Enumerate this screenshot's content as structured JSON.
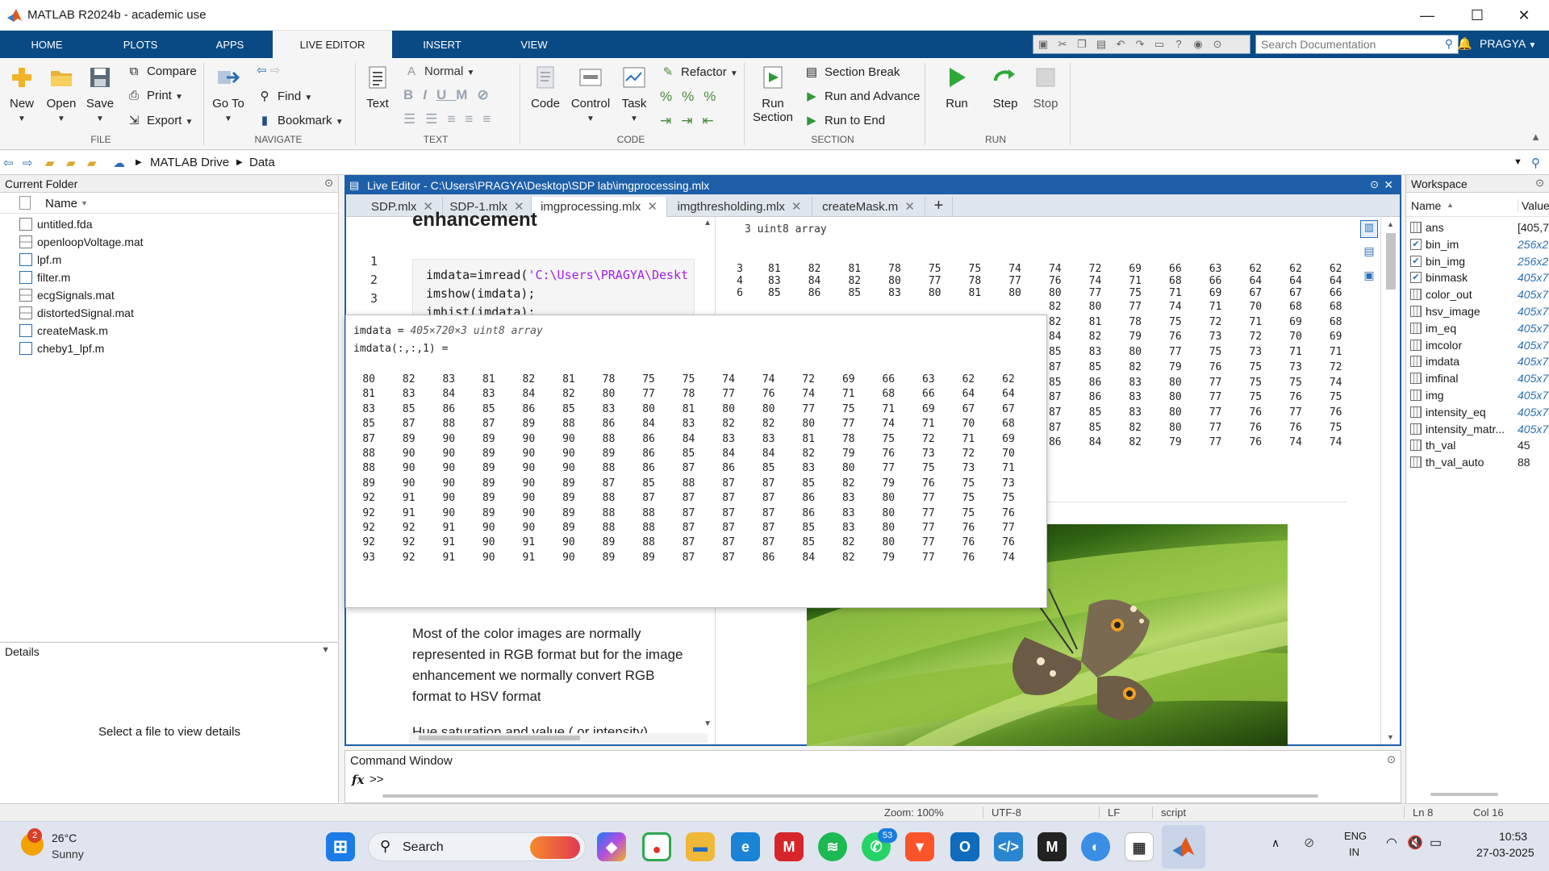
{
  "window": {
    "title": "MATLAB R2024b - academic use"
  },
  "ribbon_tabs": [
    "HOME",
    "PLOTS",
    "APPS",
    "LIVE EDITOR",
    "INSERT",
    "VIEW"
  ],
  "active_tab": "LIVE EDITOR",
  "search": {
    "placeholder": "Search Documentation"
  },
  "user": "PRAGYA",
  "ribbon": {
    "file": {
      "group": "FILE",
      "new": "New",
      "open": "Open",
      "save": "Save",
      "compare": "Compare",
      "print": "Print",
      "export": "Export"
    },
    "navigate": {
      "group": "NAVIGATE",
      "goto": "Go To",
      "find": "Find",
      "bookmark": "Bookmark"
    },
    "text": {
      "group": "TEXT",
      "text": "Text",
      "style": "Normal"
    },
    "code": {
      "group": "CODE",
      "code": "Code",
      "control": "Control",
      "task": "Task",
      "refactor": "Refactor"
    },
    "section": {
      "group": "SECTION",
      "run_section": "Run Section",
      "section_break": "Section Break",
      "run_and_advance": "Run and Advance",
      "run_to_end": "Run to End"
    },
    "run": {
      "group": "RUN",
      "run": "Run",
      "step": "Step",
      "stop": "Stop"
    }
  },
  "address": {
    "drive": "MATLAB Drive",
    "folder": "Data"
  },
  "current_folder": {
    "title": "Current Folder",
    "column": "Name",
    "files": [
      "untitled.fda",
      "openloopVoltage.mat",
      "lpf.m",
      "filter.m",
      "ecgSignals.mat",
      "distortedSignal.mat",
      "createMask.m",
      "cheby1_lpf.m"
    ]
  },
  "details": {
    "title": "Details",
    "message": "Select a file to view details"
  },
  "editor": {
    "title": "Live Editor - C:\\Users\\PRAGYA\\Desktop\\SDP lab\\imgprocessing.mlx",
    "tabs": [
      "SDP.mlx",
      "SDP-1.mlx",
      "imgprocessing.mlx",
      "imgthresholding.mlx",
      "createMask.m"
    ],
    "active_tab": "imgprocessing.mlx",
    "heading": "enhancement",
    "code": {
      "l1_prefix": "imdata=imread(",
      "l1_string": "'C:\\Users\\PRAGYA\\Deskt",
      "l2": "imshow(imdata);",
      "l3": "imhist(imdata);"
    },
    "paragraph": "Most of the color images are normally represented in RGB format but for the image enhancement we normally convert RGB format to HSV format",
    "paragraph2": "Hue saturation and value ( or intensity)"
  },
  "output": {
    "array_label": "3 uint8 array",
    "rows": [
      [
        "3",
        "81",
        "82",
        "81",
        "78",
        "75",
        "75",
        "74",
        "74",
        "72",
        "69",
        "66",
        "63",
        "62",
        "62",
        "62"
      ],
      [
        "4",
        "83",
        "84",
        "82",
        "80",
        "77",
        "78",
        "77",
        "76",
        "74",
        "71",
        "68",
        "66",
        "64",
        "64",
        "64"
      ],
      [
        "6",
        "85",
        "86",
        "85",
        "83",
        "80",
        "81",
        "80",
        "80",
        "77",
        "75",
        "71",
        "69",
        "67",
        "67",
        "66"
      ],
      [
        "82",
        "80",
        "77",
        "74",
        "71",
        "70",
        "68",
        "68"
      ],
      [
        "82",
        "81",
        "78",
        "75",
        "72",
        "71",
        "69",
        "68"
      ],
      [
        "84",
        "82",
        "79",
        "76",
        "73",
        "72",
        "70",
        "69"
      ],
      [
        "85",
        "83",
        "80",
        "77",
        "75",
        "73",
        "71",
        "71"
      ],
      [
        "87",
        "85",
        "82",
        "79",
        "76",
        "75",
        "73",
        "72"
      ],
      [
        "85",
        "86",
        "83",
        "80",
        "77",
        "75",
        "75",
        "74"
      ],
      [
        "87",
        "86",
        "83",
        "80",
        "77",
        "75",
        "76",
        "75"
      ],
      [
        "87",
        "85",
        "83",
        "80",
        "77",
        "76",
        "77",
        "76"
      ],
      [
        "87",
        "85",
        "82",
        "80",
        "77",
        "76",
        "76",
        "75"
      ],
      [
        "86",
        "84",
        "82",
        "79",
        "77",
        "76",
        "74",
        "74"
      ]
    ]
  },
  "popup": {
    "line1_name": "imdata = ",
    "line1_type": "405×720×3 uint8 array",
    "line2": "imdata(:,:,1) =",
    "rows": [
      [
        "80",
        "82",
        "83",
        "81",
        "82",
        "81",
        "78",
        "75",
        "75",
        "74",
        "74",
        "72",
        "69",
        "66",
        "63",
        "62",
        "62"
      ],
      [
        "81",
        "83",
        "84",
        "83",
        "84",
        "82",
        "80",
        "77",
        "78",
        "77",
        "76",
        "74",
        "71",
        "68",
        "66",
        "64",
        "64"
      ],
      [
        "83",
        "85",
        "86",
        "85",
        "86",
        "85",
        "83",
        "80",
        "81",
        "80",
        "80",
        "77",
        "75",
        "71",
        "69",
        "67",
        "67"
      ],
      [
        "85",
        "87",
        "88",
        "87",
        "89",
        "88",
        "86",
        "84",
        "83",
        "82",
        "82",
        "80",
        "77",
        "74",
        "71",
        "70",
        "68"
      ],
      [
        "87",
        "89",
        "90",
        "89",
        "90",
        "90",
        "88",
        "86",
        "84",
        "83",
        "83",
        "81",
        "78",
        "75",
        "72",
        "71",
        "69"
      ],
      [
        "88",
        "90",
        "90",
        "89",
        "90",
        "90",
        "89",
        "86",
        "85",
        "84",
        "84",
        "82",
        "79",
        "76",
        "73",
        "72",
        "70"
      ],
      [
        "88",
        "90",
        "90",
        "89",
        "90",
        "90",
        "88",
        "86",
        "87",
        "86",
        "85",
        "83",
        "80",
        "77",
        "75",
        "73",
        "71"
      ],
      [
        "89",
        "90",
        "90",
        "89",
        "90",
        "89",
        "87",
        "85",
        "88",
        "87",
        "87",
        "85",
        "82",
        "79",
        "76",
        "75",
        "73"
      ],
      [
        "92",
        "91",
        "90",
        "89",
        "90",
        "89",
        "88",
        "87",
        "87",
        "87",
        "87",
        "86",
        "83",
        "80",
        "77",
        "75",
        "75"
      ],
      [
        "92",
        "91",
        "90",
        "89",
        "90",
        "89",
        "88",
        "88",
        "87",
        "87",
        "87",
        "86",
        "83",
        "80",
        "77",
        "75",
        "76"
      ],
      [
        "92",
        "92",
        "91",
        "90",
        "90",
        "89",
        "88",
        "88",
        "87",
        "87",
        "87",
        "85",
        "83",
        "80",
        "77",
        "76",
        "77"
      ],
      [
        "92",
        "92",
        "91",
        "90",
        "91",
        "90",
        "89",
        "88",
        "87",
        "87",
        "87",
        "85",
        "82",
        "80",
        "77",
        "76",
        "76"
      ],
      [
        "93",
        "92",
        "91",
        "90",
        "91",
        "90",
        "89",
        "89",
        "87",
        "87",
        "86",
        "84",
        "82",
        "79",
        "77",
        "76",
        "74"
      ]
    ]
  },
  "command_window": {
    "title": "Command Window",
    "prompt": ">>"
  },
  "workspace": {
    "title": "Workspace",
    "col_name": "Name",
    "col_value": "Value",
    "vars": [
      {
        "name": "ans",
        "value": "[405,7",
        "kind": "grid"
      },
      {
        "name": "bin_im",
        "value": "256x2",
        "kind": "check"
      },
      {
        "name": "bin_img",
        "value": "256x2",
        "kind": "check"
      },
      {
        "name": "binmask",
        "value": "405x7",
        "kind": "check"
      },
      {
        "name": "color_out",
        "value": "405x7",
        "kind": "grid"
      },
      {
        "name": "hsv_image",
        "value": "405x7",
        "kind": "grid"
      },
      {
        "name": "im_eq",
        "value": "405x7",
        "kind": "grid"
      },
      {
        "name": "imcolor",
        "value": "405x7",
        "kind": "grid"
      },
      {
        "name": "imdata",
        "value": "405x7",
        "kind": "grid"
      },
      {
        "name": "imfinal",
        "value": "405x7",
        "kind": "grid"
      },
      {
        "name": "img",
        "value": "405x7",
        "kind": "grid"
      },
      {
        "name": "intensity_eq",
        "value": "405x7",
        "kind": "grid"
      },
      {
        "name": "intensity_matr...",
        "value": "405x7",
        "kind": "grid"
      },
      {
        "name": "th_val",
        "value": "45",
        "kind": "grid"
      },
      {
        "name": "th_val_auto",
        "value": "88",
        "kind": "grid"
      }
    ]
  },
  "status": {
    "zoom": "Zoom: 100%",
    "encoding": "UTF-8",
    "eol": "LF",
    "type": "script",
    "ln": "Ln 8",
    "col": "Col 16"
  },
  "taskbar": {
    "weather_temp": "26°C",
    "weather_desc": "Sunny",
    "weather_badge": "2",
    "search": "Search",
    "whatsapp_badge": "53",
    "lang1": "ENG",
    "lang2": "IN",
    "time": "10:53",
    "date": "27-03-2025"
  }
}
